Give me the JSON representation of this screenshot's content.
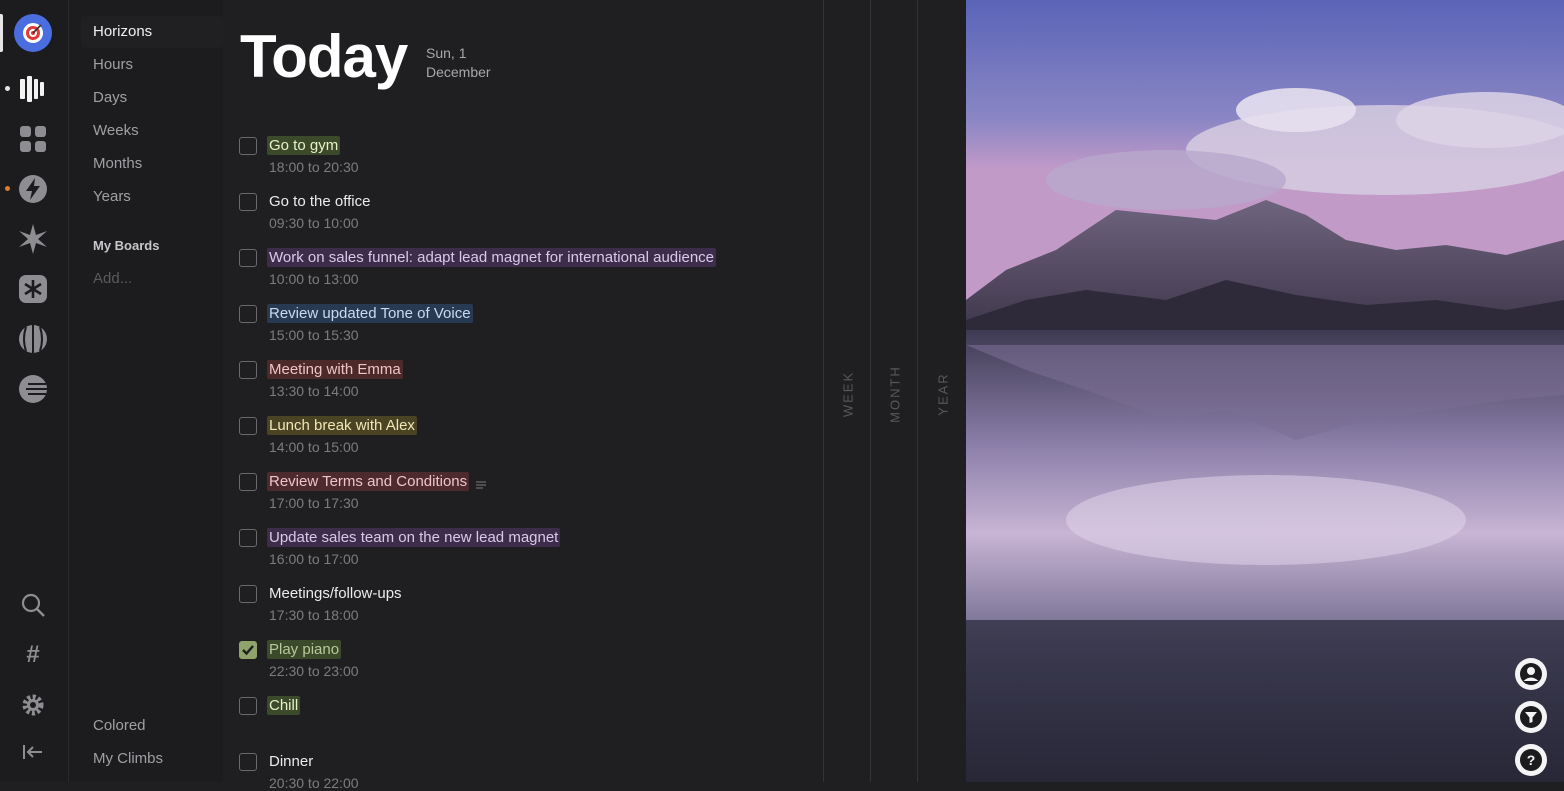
{
  "nav": {
    "items": [
      {
        "label": "Horizons",
        "active": true
      },
      {
        "label": "Hours",
        "active": false
      },
      {
        "label": "Days",
        "active": false
      },
      {
        "label": "Weeks",
        "active": false
      },
      {
        "label": "Months",
        "active": false
      },
      {
        "label": "Years",
        "active": false
      }
    ],
    "boards_heading": "My Boards",
    "add_label": "Add...",
    "bottom_items": [
      "Colored",
      "My Climbs"
    ]
  },
  "rail": {
    "icons": [
      "target-avatar-icon",
      "bars-icon",
      "grid-icon",
      "lightning-icon",
      "star-burst-icon",
      "asterisk-icon",
      "globe-icon",
      "planet-icon",
      "search-icon",
      "hash-icon",
      "gear-icon",
      "collapse-icon"
    ],
    "colors": {
      "avatar": "#4a6ee0",
      "notification_dot": "#e07a2c"
    }
  },
  "header": {
    "title": "Today",
    "date_line1": "Sun, 1",
    "date_line2": "December"
  },
  "tasks": [
    {
      "name": "Go to gym",
      "time": "18:00 to 20:30",
      "checked": false,
      "highlight": "#3b4a2a",
      "color": "#e8f0c8"
    },
    {
      "name": "Go to the office",
      "time": "09:30 to 10:00",
      "checked": false,
      "highlight": "",
      "color": "#ececec"
    },
    {
      "name": "Work on sales funnel: adapt lead magnet for international audience",
      "time": "10:00 to 13:00",
      "checked": false,
      "highlight": "#3e2d4a",
      "color": "#dcc8ec"
    },
    {
      "name": "Review updated Tone of Voice",
      "time": "15:00 to 15:30",
      "checked": false,
      "highlight": "#273a52",
      "color": "#c6dcf2"
    },
    {
      "name": "Meeting with Emma",
      "time": "13:30 to 14:00",
      "checked": false,
      "highlight": "#4c2a2a",
      "color": "#f0c4c4"
    },
    {
      "name": "Lunch break with Alex",
      "time": "14:00 to 15:00",
      "checked": false,
      "highlight": "#4a4324",
      "color": "#f2e6b4"
    },
    {
      "name": "Review Terms and Conditions",
      "time": "17:00 to 17:30",
      "checked": false,
      "highlight": "#4c2a2e",
      "color": "#f0c4c8",
      "has_notes": true
    },
    {
      "name": "Update sales team on the new lead magnet",
      "time": "16:00 to 17:00",
      "checked": false,
      "highlight": "#3e2d4a",
      "color": "#dcc8ec"
    },
    {
      "name": "Meetings/follow-ups",
      "time": "17:30 to 18:00",
      "checked": false,
      "highlight": "",
      "color": "#ececec"
    },
    {
      "name": "Play piano",
      "time": "22:30 to 23:00",
      "checked": true,
      "highlight": "#3b4a2a",
      "color": "#b8c89a"
    },
    {
      "name": "Chill",
      "time": "",
      "checked": false,
      "highlight": "#3b4a2a",
      "color": "#e8f0c8"
    },
    {
      "name": "Dinner",
      "time": "20:30 to 22:00",
      "checked": false,
      "highlight": "",
      "color": "#ececec"
    }
  ],
  "horizons": [
    "WEEK",
    "MONTH",
    "YEAR"
  ],
  "floating_buttons": [
    "user-icon",
    "filter-icon",
    "help-icon"
  ],
  "help_label": "?"
}
